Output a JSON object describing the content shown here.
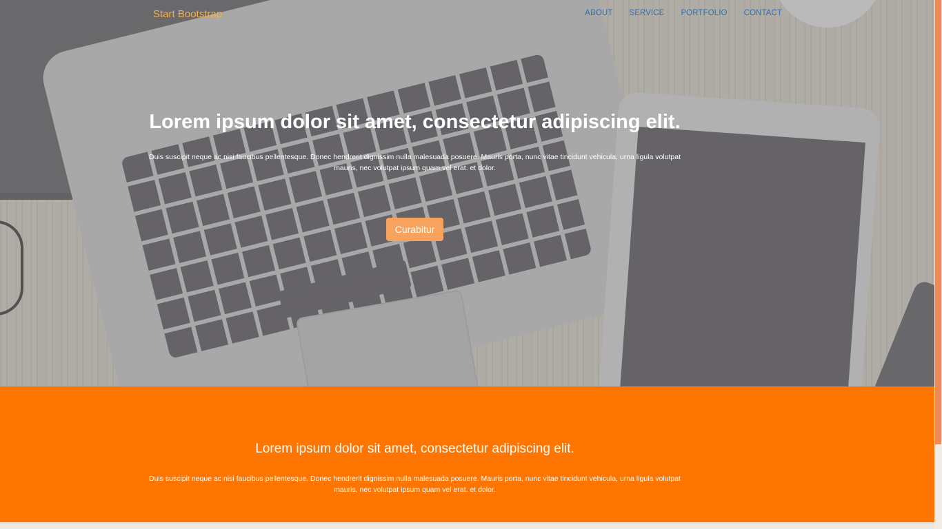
{
  "navbar": {
    "brand": "Start Bootstrap",
    "links": [
      {
        "label": "ABOUT"
      },
      {
        "label": "SERVICE"
      },
      {
        "label": "PORTFOLIO"
      },
      {
        "label": "CONTACT"
      }
    ]
  },
  "hero": {
    "title": "Lorem ipsum dolor sit amet, consectetur adipiscing elit.",
    "text": "Duis suscipit neque ac nisi faucibus pellentesque. Donec hendrerit dignissim nulla malesuada posuere. Mauris porta, nunc vitae tincidunt vehicula, urna ligula volutpat mauris, nec volutpat ipsum quam vel erat. et dolor.",
    "button_label": "Curabitur"
  },
  "section": {
    "title": "Lorem ipsum dolor sit amet, consectetur adipiscing elit.",
    "text": "Duis suscipit neque ac nisi faucibus pellentesque. Donec hendrerit dignissim nulla malesuada posuere. Mauris porta, nunc vitae tincidunt vehicula, urna ligula volutpat mauris, nec volutpat ipsum quam vel erat. et dolor."
  },
  "colors": {
    "brand": "#f4b04a",
    "nav_link": "#2d6fb3",
    "accent_orange": "#ff7502",
    "button": "#f8a35d",
    "scroll_thumb": "#f0895a"
  }
}
